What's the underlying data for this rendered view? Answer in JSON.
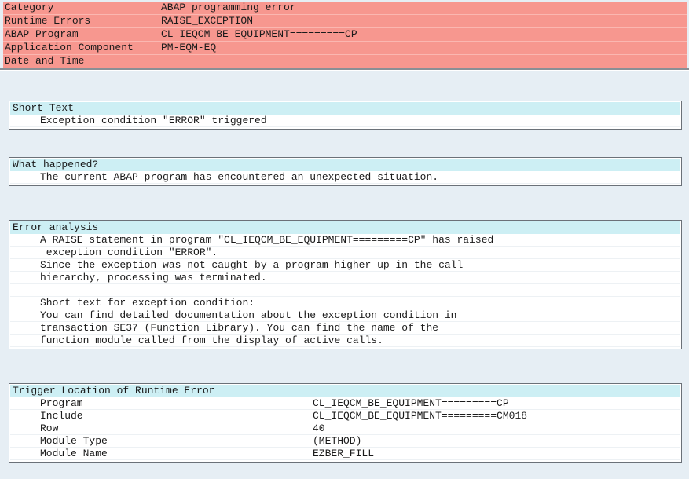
{
  "header": {
    "rows": [
      {
        "label": "Category",
        "value": "ABAP programming error"
      },
      {
        "label": "Runtime Errors",
        "value": "RAISE_EXCEPTION"
      },
      {
        "label": "ABAP Program",
        "value": "CL_IEQCM_BE_EQUIPMENT=========CP"
      },
      {
        "label": "Application Component",
        "value": "PM-EQM-EQ"
      },
      {
        "label": "Date and Time",
        "value": ""
      }
    ]
  },
  "short_text": {
    "title": "Short Text",
    "lines": [
      "Exception condition \"ERROR\" triggered"
    ]
  },
  "what_happened": {
    "title": "What happened?",
    "lines": [
      "The current ABAP program has encountered an unexpected situation."
    ]
  },
  "error_analysis": {
    "title": "Error analysis",
    "lines": [
      "A RAISE statement in program \"CL_IEQCM_BE_EQUIPMENT=========CP\" has raised",
      " exception condition \"ERROR\".",
      "Since the exception was not caught by a program higher up in the call",
      "hierarchy, processing was terminated.",
      "",
      "Short text for exception condition:",
      "You can find detailed documentation about the exception condition in",
      "transaction SE37 (Function Library). You can find the name of the",
      "function module called from the display of active calls."
    ]
  },
  "trigger_location": {
    "title": "Trigger Location of Runtime Error",
    "rows": [
      {
        "label": "Program",
        "value": "CL_IEQCM_BE_EQUIPMENT=========CP"
      },
      {
        "label": "Include",
        "value": "CL_IEQCM_BE_EQUIPMENT=========CM018"
      },
      {
        "label": "Row",
        "value": "40"
      },
      {
        "label": "Module Type",
        "value": "(METHOD)"
      },
      {
        "label": "Module Name",
        "value": "EZBER_FILL"
      }
    ]
  },
  "colors": {
    "header_bg": "#f7978f",
    "section_title_bg": "#cdeff4",
    "page_bg": "#e6eef4"
  }
}
